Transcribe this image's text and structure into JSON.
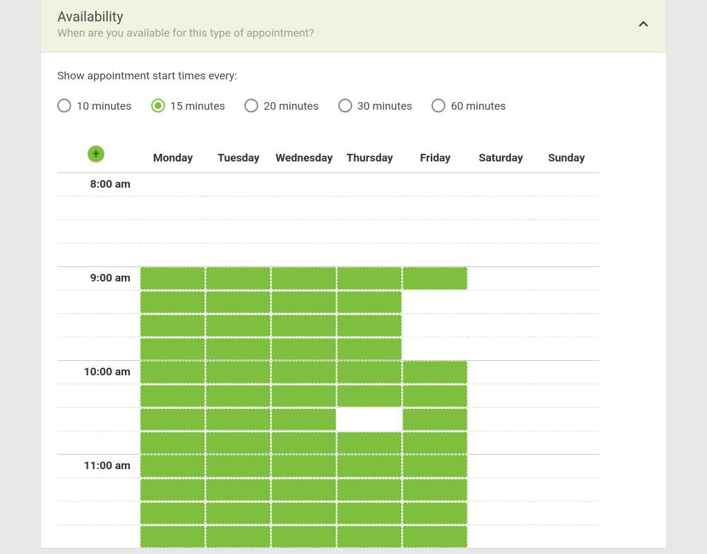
{
  "header": {
    "title": "Availability",
    "subtitle": "When are you available for this type of appointment?"
  },
  "interval": {
    "label": "Show appointment start times every:",
    "options": [
      "10 minutes",
      "15 minutes",
      "20 minutes",
      "30 minutes",
      "60 minutes"
    ],
    "selected_index": 1
  },
  "days": [
    "Monday",
    "Tuesday",
    "Wednesday",
    "Thursday",
    "Friday",
    "Saturday",
    "Sunday"
  ],
  "hours": [
    "8:00 am",
    "9:00 am",
    "10:00 am",
    "11:00 am"
  ],
  "slots_per_hour": 4,
  "availability": [
    [
      false,
      false,
      false,
      false,
      true,
      true,
      true,
      true,
      true,
      true,
      true,
      true,
      true,
      true,
      true,
      true
    ],
    [
      false,
      false,
      false,
      false,
      true,
      true,
      true,
      true,
      true,
      true,
      true,
      true,
      true,
      true,
      true,
      true
    ],
    [
      false,
      false,
      false,
      false,
      true,
      true,
      true,
      true,
      true,
      true,
      true,
      true,
      true,
      true,
      true,
      true
    ],
    [
      false,
      false,
      false,
      false,
      true,
      true,
      true,
      true,
      true,
      true,
      false,
      true,
      true,
      true,
      true,
      true
    ],
    [
      false,
      false,
      false,
      false,
      true,
      false,
      false,
      false,
      true,
      true,
      true,
      true,
      true,
      true,
      true,
      true
    ],
    [
      false,
      false,
      false,
      false,
      false,
      false,
      false,
      false,
      false,
      false,
      false,
      false,
      false,
      false,
      false,
      false
    ],
    [
      false,
      false,
      false,
      false,
      false,
      false,
      false,
      false,
      false,
      false,
      false,
      false,
      false,
      false,
      false,
      false
    ]
  ],
  "icons": {
    "add": "+"
  },
  "colors": {
    "accent": "#7fbf3f",
    "header_bg": "#eff4e0"
  }
}
